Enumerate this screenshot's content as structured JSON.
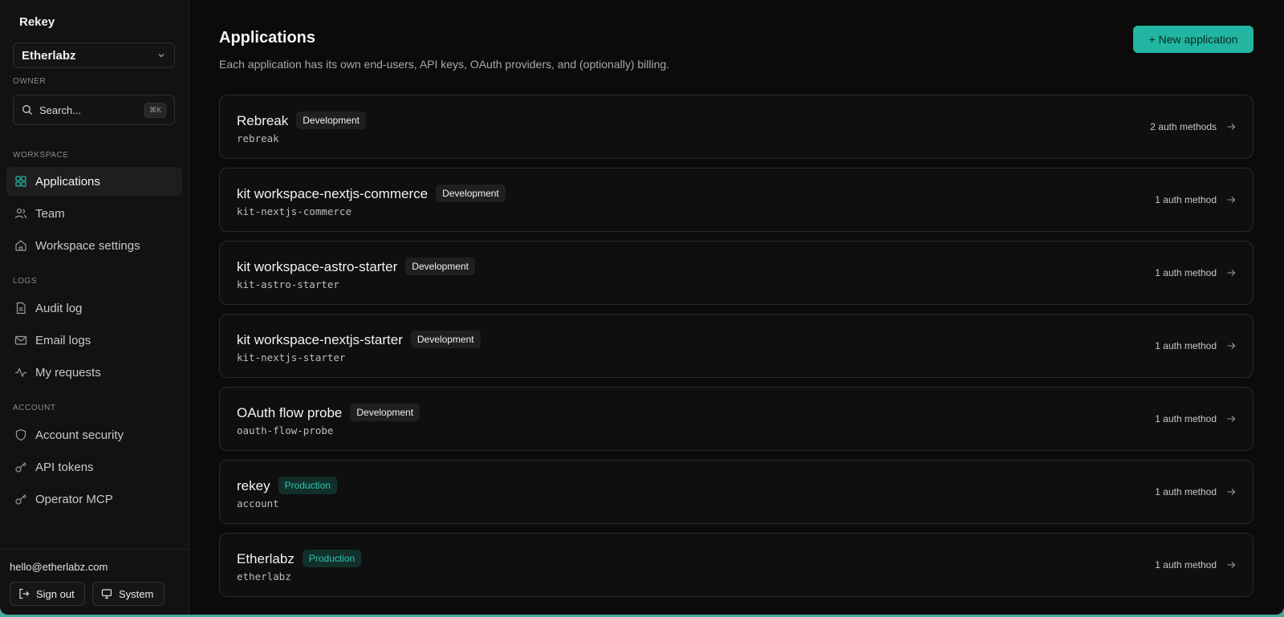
{
  "brand": "Rekey",
  "org": {
    "name": "Etherlabz",
    "role": "OWNER"
  },
  "search": {
    "placeholder": "Search...",
    "shortcut": "⌘K"
  },
  "sidebar": {
    "workspace_label": "WORKSPACE",
    "logs_label": "LOGS",
    "account_label": "ACCOUNT",
    "items": [
      {
        "label": "Applications",
        "icon": "grid-icon",
        "active": true
      },
      {
        "label": "Team",
        "icon": "users-icon"
      },
      {
        "label": "Workspace settings",
        "icon": "home-icon"
      },
      {
        "label": "Audit log",
        "icon": "file-text-icon"
      },
      {
        "label": "Email logs",
        "icon": "mail-icon"
      },
      {
        "label": "My requests",
        "icon": "activity-icon"
      },
      {
        "label": "Account security",
        "icon": "shield-icon"
      },
      {
        "label": "API tokens",
        "icon": "key-icon"
      },
      {
        "label": "Operator MCP",
        "icon": "key-icon"
      }
    ],
    "footer": {
      "email": "hello@etherlabz.com",
      "sign_out": "Sign out",
      "theme": "System"
    }
  },
  "main": {
    "title": "Applications",
    "subtitle": "Each application has its own end-users, API keys, OAuth providers, and (optionally) billing.",
    "new_button": "+ New application",
    "apps": [
      {
        "name": "Rebreak",
        "env": "Development",
        "slug": "rebreak",
        "auth": "2 auth methods"
      },
      {
        "name": "kit workspace-nextjs-commerce",
        "env": "Development",
        "slug": "kit-nextjs-commerce",
        "auth": "1 auth method"
      },
      {
        "name": "kit workspace-astro-starter",
        "env": "Development",
        "slug": "kit-astro-starter",
        "auth": "1 auth method"
      },
      {
        "name": "kit workspace-nextjs-starter",
        "env": "Development",
        "slug": "kit-nextjs-starter",
        "auth": "1 auth method"
      },
      {
        "name": "OAuth flow probe",
        "env": "Development",
        "slug": "oauth-flow-probe",
        "auth": "1 auth method"
      },
      {
        "name": "rekey",
        "env": "Production",
        "slug": "account",
        "auth": "1 auth method"
      },
      {
        "name": "Etherlabz",
        "env": "Production",
        "slug": "etherlabz",
        "auth": "1 auth method"
      }
    ]
  },
  "colors": {
    "accent": "#22b5a1",
    "production": "#2fc4ac",
    "background": "#0b0b0b",
    "sidebar": "#121212"
  }
}
